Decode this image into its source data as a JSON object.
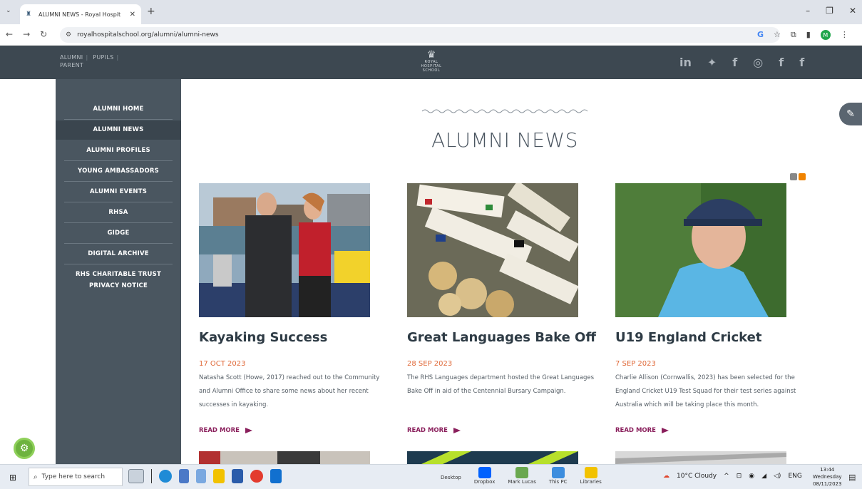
{
  "browser": {
    "tab_title": "ALUMNI NEWS - Royal Hospit",
    "url": "royalhospitalschool.org/alumni/alumni-news",
    "profile_initial": "M"
  },
  "header": {
    "links": [
      "ALUMNI",
      "PUPILS",
      "PARENT"
    ],
    "logo_lines": [
      "ROYAL",
      "HOSPITAL",
      "SCHOOL"
    ],
    "social_icons": [
      "linkedin-icon",
      "twitter-icon",
      "facebook-icon",
      "instagram-icon",
      "facebook-icon",
      "facebook-icon"
    ]
  },
  "sidebar": {
    "items": [
      {
        "label": "ALUMNI HOME"
      },
      {
        "label": "ALUMNI NEWS",
        "active": true
      },
      {
        "label": "ALUMNI PROFILES"
      },
      {
        "label": "YOUNG AMBASSADORS"
      },
      {
        "label": "ALUMNI EVENTS"
      },
      {
        "label": "RHSA"
      },
      {
        "label": "GIDGE"
      },
      {
        "label": "DIGITAL ARCHIVE"
      },
      {
        "label": "RHS CHARITABLE TRUST"
      },
      {
        "label": "PRIVACY NOTICE"
      }
    ]
  },
  "main": {
    "title": "ALUMNI NEWS",
    "read_more": "READ MORE",
    "cards": [
      {
        "title": "Kayaking Success",
        "date": "17 OCT 2023",
        "desc": "Natasha Scott (Howe, 2017) reached out to the Community and Alumni Office to share some news about her recent successes in kayaking."
      },
      {
        "title": "Great Languages Bake Off",
        "date": "28 SEP 2023",
        "desc": "The RHS Languages department hosted the Great Languages Bake Off in aid of the Centennial Bursary Campaign."
      },
      {
        "title": "U19 England Cricket",
        "date": "7 SEP 2023",
        "desc": "Charlie Allison (Cornwallis, 2023) has been selected for the England Cricket U19 Test Squad for their test series against Australia which will be taking place this month."
      }
    ]
  },
  "taskbar": {
    "search_placeholder": "Type here to search",
    "desktop": "Desktop",
    "pinned": [
      "Dropbox",
      "Mark Lucas",
      "This PC",
      "Libraries"
    ],
    "weather": "10°C Cloudy",
    "lang": "ENG",
    "time": "13:44",
    "day": "Wednesday",
    "date": "08/11/2023"
  },
  "colors": {
    "header_bg": "#3d4851",
    "sidebar_bg": "#4a5660",
    "date_orange": "#e06a3a",
    "read_more_purple": "#8a1f5c"
  }
}
